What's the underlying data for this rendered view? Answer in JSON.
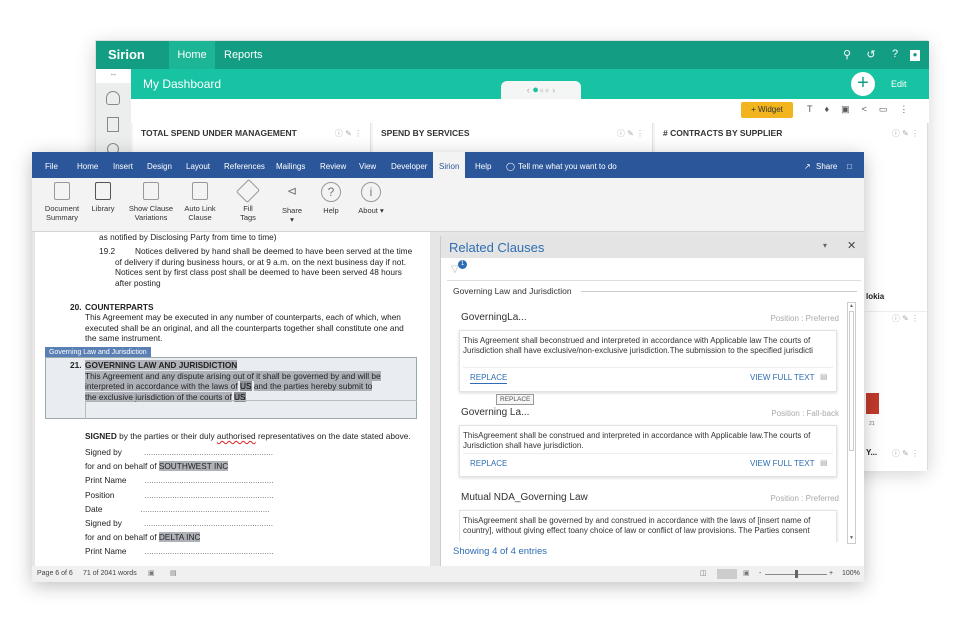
{
  "dashboard": {
    "logo": "Sirion",
    "nav": [
      {
        "label": "Home",
        "active": true
      },
      {
        "label": "Reports"
      }
    ],
    "header_icons": [
      "search-icon",
      "history-icon",
      "help-icon",
      "user-icon"
    ],
    "title": "My Dashboard",
    "pager_arrows": [
      "‹",
      "›"
    ],
    "add_label": "+",
    "edit_label": "Edit",
    "widget_button": "+ Widget",
    "toolbar_icons": [
      "text-icon",
      "bookmark-icon",
      "pdf-icon",
      "share-icon",
      "monitor-icon",
      "more-icon"
    ],
    "widgets": [
      {
        "title": "TOTAL SPEND UNDER MANAGEMENT"
      },
      {
        "title": "SPEND BY SERVICES"
      },
      {
        "title": "# CONTRACTS BY SUPPLIER",
        "partial_label": "lokia",
        "axis_tick": "21",
        "next_title": "Y..."
      }
    ],
    "colors": {
      "topbar": "#139e84",
      "subbar": "#17c3a3",
      "widget_button": "#f3b51e",
      "bar": "#c0392b"
    }
  },
  "word": {
    "tabs": [
      "File",
      "Home",
      "Insert",
      "Design",
      "Layout",
      "References",
      "Mailings",
      "Review",
      "View",
      "Developer",
      "Sirion",
      "Help"
    ],
    "active_tab": "Sirion",
    "tell_me": "Tell me what you want to do",
    "share": "Share",
    "ribbon": [
      {
        "label": "Document Summary"
      },
      {
        "label": "Library"
      },
      {
        "label": "Show Clause Variations"
      },
      {
        "label": "Auto Link Clause"
      },
      {
        "label": "Fill Tags"
      },
      {
        "label": "Share ▾"
      },
      {
        "label": "Help"
      },
      {
        "label": "About ▾"
      }
    ],
    "document": {
      "line0": "as notified by Disclosing Party from time to time)",
      "s19_2_num": "19.2",
      "s19_2": "Notices delivered by hand shall be deemed to have been served at the time of delivery if during business hours, or at 9 a.m. on the next business day if not. Notices sent by first class post shall be deemed to have been served 48 hours after posting",
      "s20_num": "20.",
      "s20_title": "COUNTERPARTS",
      "s20_text": "This Agreement may be executed in any number of counterparts, each of which, when executed shall be an original, and all the counterparts together shall constitute one and the same instrument.",
      "tag": "Governing Law and Jurisdiction",
      "s21_num": "21.",
      "s21_title": "GOVERNING LAW AND JURISDICTION",
      "s21_a": "This Agreement and any dispute arising out of it shall be governed by and will be interpreted in accordance with the laws of",
      "s21_us": "US",
      "s21_b": "and the parties hereby submit to the exclusive jurisdiction of the courts of",
      "signed_bold": "SIGNED",
      "signed_rest": "by the parties or their duly",
      "signed_misspelled": "authorised",
      "signed_end": "representatives on the date stated above.",
      "sig": [
        {
          "label": "Signed by",
          "dots": "........................................................"
        },
        {
          "label": "for and on behalf of",
          "party": "SOUTHWEST INC"
        },
        {
          "label": "Print Name",
          "dots": "........................................................"
        },
        {
          "label": "Position",
          "dots": "........................................................"
        },
        {
          "label": "Date",
          "dots": "........................................................"
        },
        {
          "label": "Signed by",
          "dots": "........................................................"
        },
        {
          "label": "for and on behalf of",
          "party": "DELTA INC"
        },
        {
          "label": "Print Name",
          "dots": "........................................................"
        }
      ]
    },
    "pane": {
      "title": "Related Clauses",
      "filter_badge": "1",
      "group": "Governing Law and Jurisdiction",
      "clauses": [
        {
          "name": "GoverningLa...",
          "pos_label": "Position",
          "pos_sep": ":",
          "position": "Preferred",
          "text": "This Agreement shall beconstrued and interpreted in accordance with Applicable law The courts of Jurisdiction shall have exclusive/non-exclusive jurisdiction.The submission to the specified jurisdicti",
          "replace": "REPLACE",
          "view": "VIEW FULL TEXT"
        },
        {
          "name": "Governing La...",
          "pos_label": "Position",
          "pos_sep": ":",
          "position": "Fall-back",
          "text": "ThisAgreement shall be construed and interpreted in accordance with Applicable law.The courts of Jurisdiction shall have jurisdiction.",
          "replace": "REPLACE",
          "view": "VIEW FULL TEXT"
        },
        {
          "name": "Mutual NDA_Governing Law",
          "pos_label": "Position",
          "pos_sep": ":",
          "position": "Preferred",
          "text": "ThisAgreement shall be governed by and construed in accordance with the laws of [insert name of country], without giving effect toany choice of law or conflict of law provisions. The Parties consent"
        }
      ],
      "tooltip": "REPLACE",
      "footer": "Showing 4 of 4 entries"
    },
    "status": {
      "page": "Page 6 of 6",
      "words": "71 of 2041 words",
      "zoom": "100%",
      "zoom_minus": "-",
      "zoom_plus": "+"
    },
    "colors": {
      "ribbon_tabs": "#2b579a",
      "pane_title": "#2e6db4"
    }
  }
}
